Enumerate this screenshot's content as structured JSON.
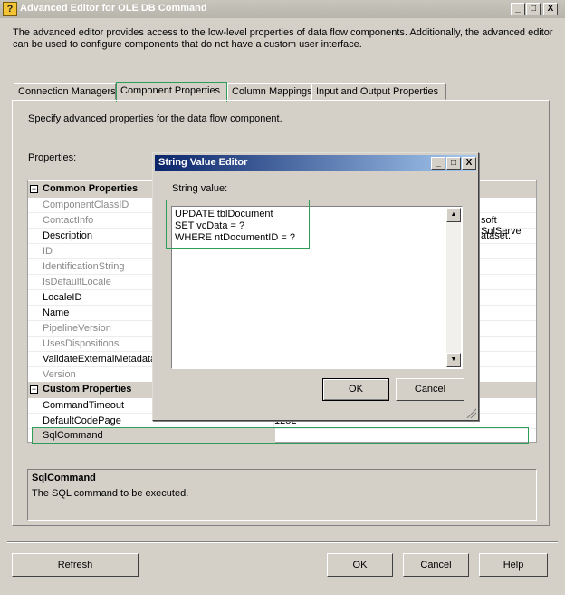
{
  "window": {
    "title": "Advanced Editor for OLE DB Command",
    "icon_glyph": "?",
    "controls": {
      "minimize": "_",
      "maximize": "□",
      "close": "X"
    }
  },
  "description": "The advanced editor provides access to the low-level properties of data flow components. Additionally, the advanced editor can be used to configure components that do not have a custom user interface.",
  "tabs": [
    {
      "label": "Connection Managers"
    },
    {
      "label": "Component Properties"
    },
    {
      "label": "Column Mappings"
    },
    {
      "label": "Input and Output Properties"
    }
  ],
  "panel": {
    "title": "Specify advanced properties for the data flow component.",
    "properties_label": "Properties:"
  },
  "grid": {
    "common_category": "Common Properties",
    "custom_category": "Custom Properties",
    "common_rows": [
      {
        "name": "ComponentClassID",
        "value": ""
      },
      {
        "name": "ContactInfo",
        "value": "soft SqlServe"
      },
      {
        "name": "Description",
        "value": "ataset."
      },
      {
        "name": "ID",
        "value": ""
      },
      {
        "name": "IdentificationString",
        "value": ""
      },
      {
        "name": "IsDefaultLocale",
        "value": ""
      },
      {
        "name": "LocaleID",
        "value": ""
      },
      {
        "name": "Name",
        "value": ""
      },
      {
        "name": "PipelineVersion",
        "value": ""
      },
      {
        "name": "UsesDispositions",
        "value": ""
      },
      {
        "name": "ValidateExternalMetadata",
        "value": ""
      },
      {
        "name": "Version",
        "value": ""
      }
    ],
    "custom_rows": [
      {
        "name": "CommandTimeout",
        "value": ""
      },
      {
        "name": "DefaultCodePage",
        "value": "1252"
      },
      {
        "name": "SqlCommand",
        "value": ""
      }
    ]
  },
  "help": {
    "title": "SqlCommand",
    "text": "The SQL command to be executed."
  },
  "buttons": {
    "refresh": "Refresh",
    "ok": "OK",
    "cancel": "Cancel",
    "help": "Help"
  },
  "dialog": {
    "title": "String Value Editor",
    "label": "String value:",
    "value": "UPDATE tblDocument\nSET vcData = ?\nWHERE ntDocumentID = ?",
    "ok": "OK",
    "cancel": "Cancel",
    "controls": {
      "minimize": "_",
      "maximize": "□",
      "close": "X"
    }
  }
}
